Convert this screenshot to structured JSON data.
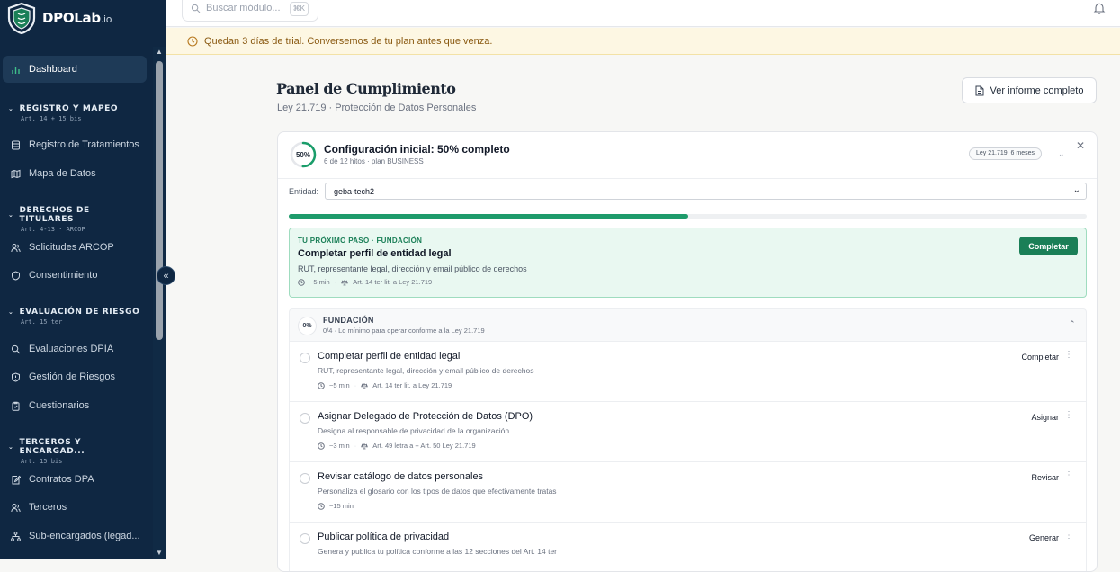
{
  "brand": {
    "name": "DPOLab",
    "suffix": ".io"
  },
  "topbar": {
    "search_placeholder": "Buscar módulo...",
    "shortcut": "⌘K"
  },
  "banner": {
    "text": "Quedan 3 días de trial. Conversemos de tu plan antes que venza."
  },
  "sidebar": {
    "dashboard": "Dashboard",
    "sections": [
      {
        "title": "REGISTRO Y MAPEO",
        "sub": "Art. 14 + 15 bis",
        "items": [
          "Registro de Tratamientos",
          "Mapa de Datos"
        ]
      },
      {
        "title": "DERECHOS DE TITULARES",
        "sub": "Art. 4-13 · ARCOP",
        "items": [
          "Solicitudes ARCOP",
          "Consentimiento"
        ]
      },
      {
        "title": "EVALUACIÓN DE RIESGO",
        "sub": "Art. 15 ter",
        "items": [
          "Evaluaciones DPIA",
          "Gestión de Riesgos",
          "Cuestionarios"
        ]
      },
      {
        "title": "TERCEROS Y ENCARGAD...",
        "sub": "Art. 15 bis",
        "items": [
          "Contratos DPA",
          "Terceros",
          "Sub-encargados (legad..."
        ]
      }
    ]
  },
  "page": {
    "title": "Panel de Cumplimiento",
    "subtitle": "Ley 21.719 · Protección de Datos Personales",
    "report_button": "Ver informe completo"
  },
  "progress_card": {
    "percent_label": "50%",
    "progress": 0.5,
    "title": "Configuración inicial: 50% completo",
    "subtitle": "6 de 12 hitos · plan BUSINESS",
    "pill": "Ley 21.719: 6 meses",
    "entity_label": "Entidad:",
    "entity_value": "geba-tech2"
  },
  "next_step": {
    "tag": "TU PRÓXIMO PASO · FUNDACIÓN",
    "title": "Completar perfil de entidad legal",
    "desc": "RUT, representante legal, dirección y email público de derechos",
    "time": "~5 min",
    "ref": "Art. 14 ter lit. a Ley 21.719",
    "button": "Completar"
  },
  "foundation": {
    "badge": "0%",
    "title": "FUNDACIÓN",
    "subtitle": "0/4 · Lo mínimo para operar conforme a la Ley 21.719"
  },
  "tasks": [
    {
      "title": "Completar perfil de entidad legal",
      "desc": "RUT, representante legal, dirección y email público de derechos",
      "time": "~5 min",
      "ref": "Art. 14 ter lit. a Ley 21.719",
      "action": "Completar"
    },
    {
      "title": "Asignar Delegado de Protección de Datos (DPO)",
      "desc": "Designa al responsable de privacidad de la organización",
      "time": "~3 min",
      "ref": "Art. 49 letra a + Art. 50 Ley 21.719",
      "action": "Asignar"
    },
    {
      "title": "Revisar catálogo de datos personales",
      "desc": "Personaliza el glosario con los tipos de datos que efectivamente tratas",
      "time": "~15 min",
      "ref": "",
      "action": "Revisar"
    },
    {
      "title": "Publicar política de privacidad",
      "desc": "Genera y publica tu política conforme a las 12 secciones del Art. 14 ter",
      "time": "",
      "ref": "",
      "action": "Generar"
    }
  ],
  "colors": {
    "sidebar": "#0f2742",
    "accent": "#1a7f57",
    "banner_bg": "#fdf7e3",
    "banner_text": "#8a5a12"
  }
}
